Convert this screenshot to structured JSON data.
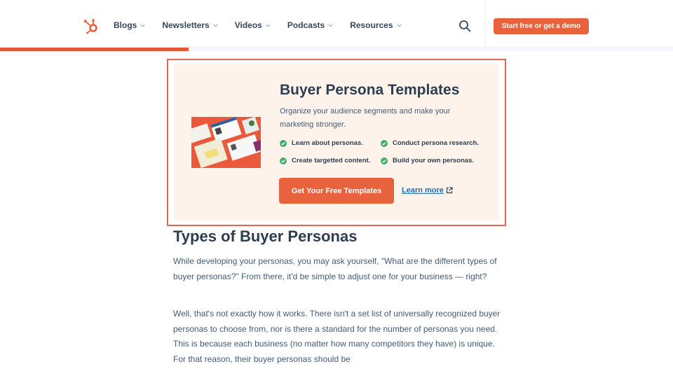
{
  "header": {
    "logo": "hubspot-logo",
    "nav": [
      {
        "label": "Blogs"
      },
      {
        "label": "Newsletters"
      },
      {
        "label": "Videos"
      },
      {
        "label": "Podcasts"
      },
      {
        "label": "Resources"
      }
    ],
    "search_icon": "search-icon",
    "cta_label": "Start free or get a demo"
  },
  "reading_progress": {
    "percent": 28
  },
  "promo": {
    "title": "Buyer Persona Templates",
    "description": "Organize your audience segments and make your marketing stronger.",
    "bullets": [
      "Learn about personas.",
      "Conduct persona research.",
      "Create targetted content.",
      "Build your own personas."
    ],
    "primary_button": "Get Your Free Templates",
    "secondary_link": "Learn more",
    "image": "buyer-persona-templates-preview"
  },
  "article": {
    "heading": "Types of Buyer Personas",
    "paragraphs": [
      "While developing your personas, you may ask yourself, \"What are the different types of buyer personas?\" From there, it'd be simple to adjust one for your business — right?",
      "Well, that's not exactly how it works. There isn't a set list of universally recognized buyer personas to choose from, nor is there a standard for the number of personas you need. This is because each business (no matter how many competitors they have) is unique. For that reason, their buyer personas should be"
    ]
  },
  "colors": {
    "accent": "#e8623d",
    "heading": "#2d3e50",
    "body_text": "#425b76",
    "promo_bg": "#fdf3ea",
    "check_green": "#3fae6a",
    "link": "#1f6fb2"
  }
}
